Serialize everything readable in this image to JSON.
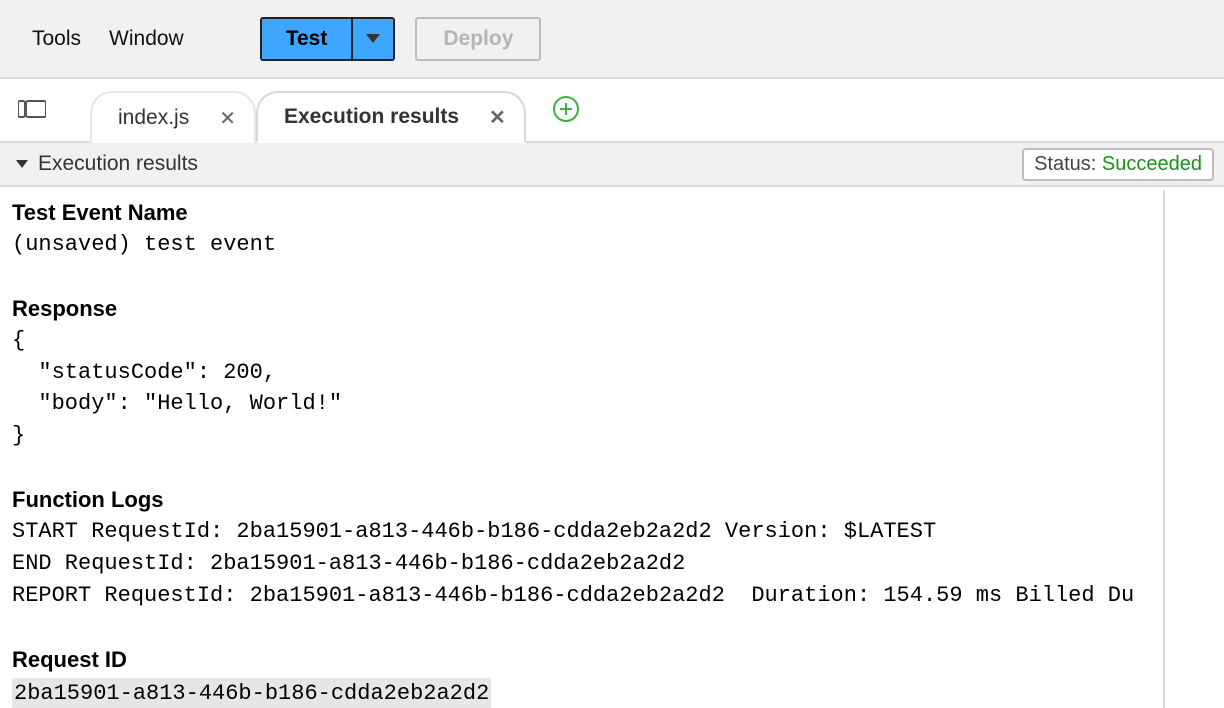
{
  "menu": {
    "tools": "Tools",
    "window": "Window"
  },
  "toolbar": {
    "test_label": "Test",
    "deploy_label": "Deploy"
  },
  "tabs": {
    "file": "index.js",
    "results": "Execution results"
  },
  "panel": {
    "title": "Execution results",
    "status_label": "Status: ",
    "status_value": "Succeeded"
  },
  "result": {
    "test_event_heading": "Test Event Name",
    "test_event_value": "(unsaved) test event",
    "response_heading": "Response",
    "response_body": "{\n  \"statusCode\": 200,\n  \"body\": \"Hello, World!\"\n}",
    "logs_heading": "Function Logs",
    "logs_body": "START RequestId: 2ba15901-a813-446b-b186-cdda2eb2a2d2 Version: $LATEST\nEND RequestId: 2ba15901-a813-446b-b186-cdda2eb2a2d2\nREPORT RequestId: 2ba15901-a813-446b-b186-cdda2eb2a2d2  Duration: 154.59 ms Billed Du",
    "request_id_heading": "Request ID",
    "request_id_value": "2ba15901-a813-446b-b186-cdda2eb2a2d2"
  }
}
